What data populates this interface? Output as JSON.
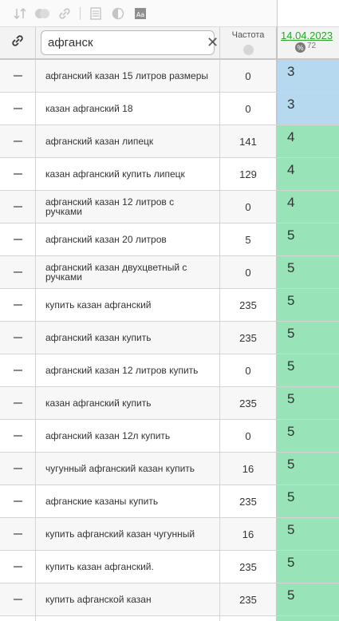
{
  "toolbar": {
    "icons": [
      "sort-icon",
      "toggle-icon",
      "link-icon",
      "table-icon",
      "contrast-icon",
      "font-icon"
    ]
  },
  "header": {
    "search_value": "афганск",
    "clear_symbol": "✕",
    "frequency_label": "Частота",
    "date_label": "14.04.2023",
    "percent_symbol": "%",
    "date_count": "72"
  },
  "colors": {
    "pos_top3": "#b7d9ef",
    "pos_4_10": "#98e3b8",
    "date_link": "#29a829"
  },
  "rows": [
    {
      "keyword": "афганский казан 15 литров размеры",
      "frequency": "0",
      "position": "3"
    },
    {
      "keyword": "казан афганский 18",
      "frequency": "0",
      "position": "3"
    },
    {
      "keyword": "афганский казан липецк",
      "frequency": "141",
      "position": "4"
    },
    {
      "keyword": "казан афганский купить липецк",
      "frequency": "129",
      "position": "4"
    },
    {
      "keyword": "афганский казан 12 литров с ручками",
      "frequency": "0",
      "position": "4"
    },
    {
      "keyword": "афганский казан 20 литров",
      "frequency": "5",
      "position": "5"
    },
    {
      "keyword": "афганский казан двухцветный с ручками",
      "frequency": "0",
      "position": "5"
    },
    {
      "keyword": "купить казан афганский",
      "frequency": "235",
      "position": "5"
    },
    {
      "keyword": "афганский казан купить",
      "frequency": "235",
      "position": "5"
    },
    {
      "keyword": "афганский казан 12 литров купить",
      "frequency": "0",
      "position": "5"
    },
    {
      "keyword": "казан афганский купить",
      "frequency": "235",
      "position": "5"
    },
    {
      "keyword": "афганский казан 12л купить",
      "frequency": "0",
      "position": "5"
    },
    {
      "keyword": "чугунный афганский казан купить",
      "frequency": "16",
      "position": "5"
    },
    {
      "keyword": "афганские казаны купить",
      "frequency": "235",
      "position": "5"
    },
    {
      "keyword": "купить афганский казан чугунный",
      "frequency": "16",
      "position": "5"
    },
    {
      "keyword": "купить казан афганский.",
      "frequency": "235",
      "position": "5"
    },
    {
      "keyword": "купить афганской казан",
      "frequency": "235",
      "position": "5"
    },
    {
      "keyword": "",
      "frequency": "",
      "position": ""
    }
  ]
}
